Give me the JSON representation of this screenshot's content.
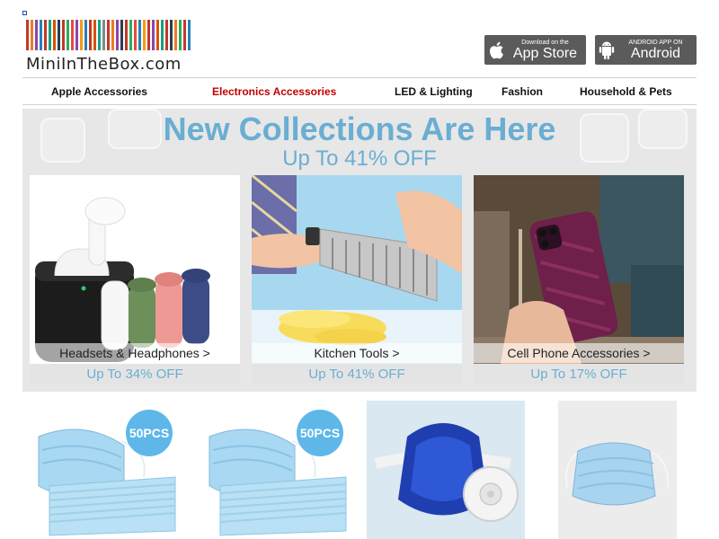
{
  "header": {
    "logo_text": "MiniInTheBox.com",
    "logo_stripe_colors": [
      "#c0392b",
      "#e67e22",
      "#8e44ad",
      "#2980b9",
      "#c0392b",
      "#16a085",
      "#d35400",
      "#2c3e50",
      "#c0392b",
      "#27ae60",
      "#e74c3c",
      "#8e44ad",
      "#f39c12",
      "#2980b9",
      "#c0392b",
      "#d35400",
      "#16a085",
      "#7f8c8d",
      "#c0392b",
      "#e67e22",
      "#8e44ad",
      "#2c3e50",
      "#c0392b",
      "#27ae60",
      "#e74c3c",
      "#2980b9",
      "#f39c12",
      "#c0392b",
      "#8e44ad",
      "#d35400",
      "#16a085",
      "#c0392b",
      "#2c3e50",
      "#e67e22",
      "#27ae60",
      "#c0392b",
      "#2980b9"
    ],
    "app_store": {
      "small": "Download on the",
      "big": "App Store",
      "icon": "apple-icon"
    },
    "android": {
      "small": "ANDROID APP ON",
      "big": "Android",
      "icon": "android-icon"
    }
  },
  "nav": {
    "items": [
      {
        "label": "Apple Accessories",
        "active": false
      },
      {
        "label": "Electronics Accessories",
        "active": true
      },
      {
        "label": "LED & Lighting",
        "active": false
      },
      {
        "label": "Fashion",
        "active": false
      },
      {
        "label": "Household & Pets",
        "active": false
      }
    ],
    "active_color": "#c00000"
  },
  "banner": {
    "title": "New Collections Are Here",
    "subtitle": "Up To 41% OFF",
    "accent_color": "#6aaed2"
  },
  "categories": [
    {
      "label": "Headsets & Headphones >",
      "discount": "Up To 34% OFF"
    },
    {
      "label": "Kitchen Tools >",
      "discount": "Up To 41% OFF"
    },
    {
      "label": "Cell Phone Accessories >",
      "discount": "Up To 17% OFF"
    }
  ],
  "products": [
    {
      "badge": "50PCS"
    },
    {
      "badge": "50PCS"
    },
    {
      "badge": ""
    },
    {
      "badge": ""
    }
  ]
}
